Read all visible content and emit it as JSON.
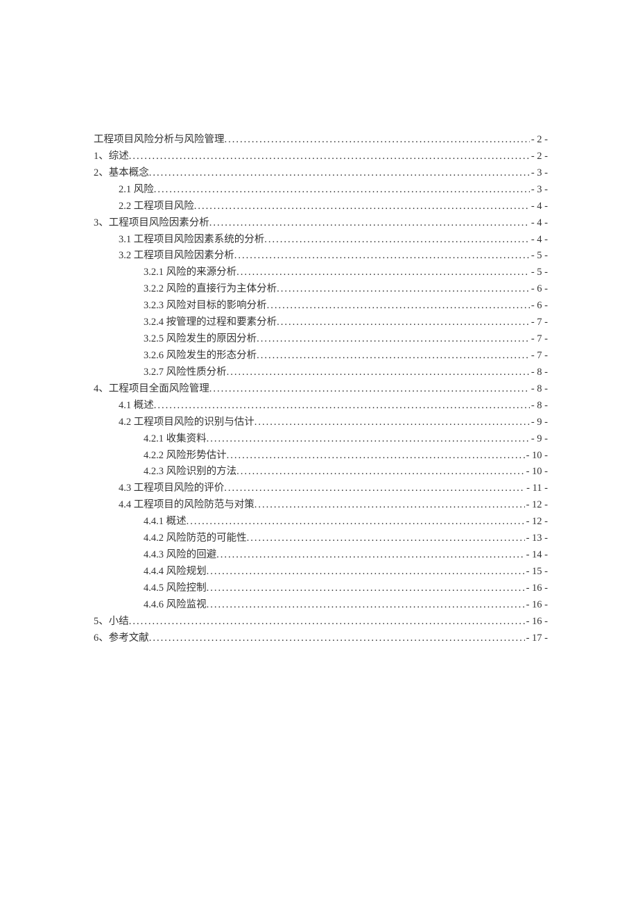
{
  "toc": [
    {
      "title": "工程项目风险分析与风险管理",
      "page": "- 2 -",
      "indent": 0
    },
    {
      "title": "1、综述",
      "page": "- 2 -",
      "indent": 0
    },
    {
      "title": "2、基本概念",
      "page": "- 3 -",
      "indent": 0
    },
    {
      "title": "2.1 风险",
      "page": "- 3 -",
      "indent": 1
    },
    {
      "title": "2.2 工程项目风险",
      "page": "- 4 -",
      "indent": 1
    },
    {
      "title": "3、工程项目风险因素分析",
      "page": "- 4 -",
      "indent": 0
    },
    {
      "title": "3.1 工程项目风险因素系统的分析",
      "page": "- 4 -",
      "indent": 1
    },
    {
      "title": "3.2 工程项目风险因素分析",
      "page": "- 5 -",
      "indent": 1
    },
    {
      "title": "3.2.1 风险的来源分析",
      "page": "- 5 -",
      "indent": 2
    },
    {
      "title": "3.2.2 风险的直接行为主体分析",
      "page": "- 6 -",
      "indent": 2
    },
    {
      "title": "3.2.3 风险对目标的影响分析",
      "page": "- 6 -",
      "indent": 2
    },
    {
      "title": "3.2.4 按管理的过程和要素分析",
      "page": "- 7 -",
      "indent": 2
    },
    {
      "title": "3.2.5 风险发生的原因分析",
      "page": "- 7 -",
      "indent": 2
    },
    {
      "title": "3.2.6 风险发生的形态分析",
      "page": "- 7 -",
      "indent": 2
    },
    {
      "title": "3.2.7 风险性质分析",
      "page": "- 8 -",
      "indent": 2
    },
    {
      "title": "4、工程项目全面风险管理",
      "page": "- 8 -",
      "indent": 0
    },
    {
      "title": "4.1 概述",
      "page": "- 8 -",
      "indent": 1
    },
    {
      "title": "4.2 工程项目风险的识别与估计",
      "page": "- 9 -",
      "indent": 1
    },
    {
      "title": "4.2.1 收集资料",
      "page": "- 9 -",
      "indent": 2
    },
    {
      "title": "4.2.2 风险形势估计",
      "page": "- 10 -",
      "indent": 2
    },
    {
      "title": "4.2.3 风险识别的方法",
      "page": "- 10 -",
      "indent": 2
    },
    {
      "title": "4.3 工程项目风险的评价",
      "page": "- 11 -",
      "indent": 1
    },
    {
      "title": "4.4 工程项目的风险防范与对策",
      "page": "- 12 -",
      "indent": 1
    },
    {
      "title": "4.4.1 概述",
      "page": "- 12 -",
      "indent": 2
    },
    {
      "title": "4.4.2 风险防范的可能性",
      "page": "- 13 -",
      "indent": 2
    },
    {
      "title": "4.4.3 风险的回避",
      "page": "- 14 -",
      "indent": 2
    },
    {
      "title": "4.4.4 风险规划",
      "page": "- 15 -",
      "indent": 2
    },
    {
      "title": "4.4.5 风险控制",
      "page": "- 16 -",
      "indent": 2
    },
    {
      "title": "4.4.6 风险监视",
      "page": "- 16 -",
      "indent": 2
    },
    {
      "title": "5、小结",
      "page": "- 16 -",
      "indent": 0
    },
    {
      "title": "6、参考文献",
      "page": "- 17 -",
      "indent": 0
    }
  ]
}
